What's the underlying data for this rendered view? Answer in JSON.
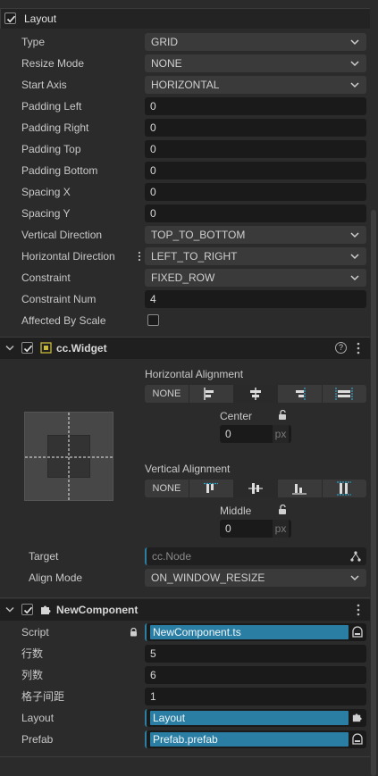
{
  "layout": {
    "title": "Layout",
    "fields": [
      {
        "label": "Type",
        "value": "GRID",
        "kind": "select"
      },
      {
        "label": "Resize Mode",
        "value": "NONE",
        "kind": "select"
      },
      {
        "label": "Start Axis",
        "value": "HORIZONTAL",
        "kind": "select"
      },
      {
        "label": "Padding Left",
        "value": "0",
        "kind": "input"
      },
      {
        "label": "Padding Right",
        "value": "0",
        "kind": "input"
      },
      {
        "label": "Padding Top",
        "value": "0",
        "kind": "input"
      },
      {
        "label": "Padding Bottom",
        "value": "0",
        "kind": "input"
      },
      {
        "label": "Spacing X",
        "value": "0",
        "kind": "input"
      },
      {
        "label": "Spacing Y",
        "value": "0",
        "kind": "input"
      },
      {
        "label": "Vertical Direction",
        "value": "TOP_TO_BOTTOM",
        "kind": "select"
      },
      {
        "label": "Horizontal Direction",
        "value": "LEFT_TO_RIGHT",
        "kind": "select"
      },
      {
        "label": "Constraint",
        "value": "FIXED_ROW",
        "kind": "select"
      },
      {
        "label": "Constraint Num",
        "value": "4",
        "kind": "input"
      },
      {
        "label": "Affected By Scale",
        "value": "",
        "kind": "checkbox"
      }
    ]
  },
  "widget": {
    "title": "cc.Widget",
    "help_icon": "?",
    "horizontal_alignment_label": "Horizontal Alignment",
    "h_none": "NONE",
    "center_label": "Center",
    "center_value": "0",
    "unit": "px",
    "vertical_alignment_label": "Vertical Alignment",
    "v_none": "NONE",
    "middle_label": "Middle",
    "middle_value": "0",
    "target_label": "Target",
    "target_value": "cc.Node",
    "align_mode_label": "Align Mode",
    "align_mode_value": "ON_WINDOW_RESIZE"
  },
  "new_component": {
    "title": "NewComponent",
    "script_label": "Script",
    "script_value": "NewComponent.ts",
    "rows_label": "行数",
    "rows_value": "5",
    "cols_label": "列数",
    "cols_value": "6",
    "spacing_label": "格子间距",
    "spacing_value": "1",
    "layout_label": "Layout",
    "layout_value": "Layout",
    "prefab_label": "Prefab",
    "prefab_value": "Prefab.prefab"
  }
}
